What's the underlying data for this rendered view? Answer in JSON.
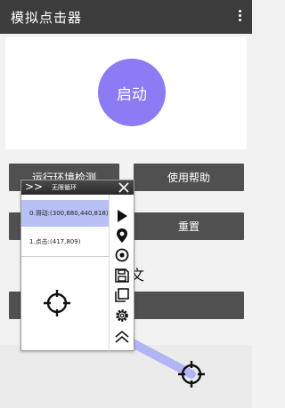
{
  "app": {
    "title": "模拟点击器"
  },
  "start_button": {
    "label": "启动"
  },
  "buttons": {
    "env_check": "运行环境检测",
    "help": "使用帮助",
    "reset": "重置",
    "left_row2": "",
    "left_row3": "",
    "right_row3": ""
  },
  "partial_text": "文",
  "panel": {
    "collapse_label": ">>",
    "mode_label": "无限循环",
    "items": [
      {
        "text": "0.滑动:(300,680,440,818)"
      },
      {
        "text": "1.点击:(417,809)"
      }
    ],
    "tools": [
      "play-icon",
      "location-pin-icon",
      "target-icon",
      "save-icon",
      "copy-icon",
      "settings-icon",
      "chevron-up-icon"
    ]
  },
  "colors": {
    "accent": "#8b7cf6",
    "appbar": "#3c3c3c",
    "button": "#505050",
    "selection": "#b7c1f5"
  }
}
